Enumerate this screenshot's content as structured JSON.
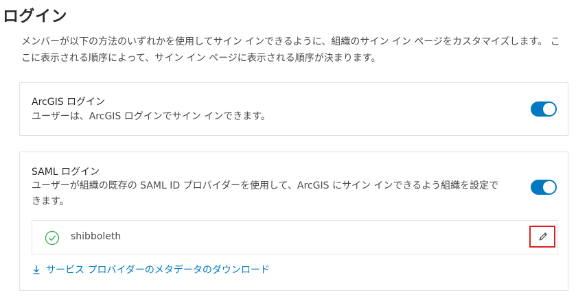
{
  "page": {
    "title": "ログイン",
    "intro": "メンバーが以下の方法のいずれかを使用してサイン インできるように、組織のサイン イン ページをカスタマイズします。 ここに表示される順序によって、サイン イン ページに表示される順序が決まります。"
  },
  "arcgis_login": {
    "title": "ArcGIS ログイン",
    "description": "ユーザーは、ArcGIS ログインでサイン インできます。",
    "enabled": true
  },
  "saml_login": {
    "title": "SAML ログイン",
    "description": "ユーザーが組織の既存の SAML ID プロバイダーを使用して、ArcGIS にサイン インできるよう組織を設定できます。",
    "enabled": true,
    "provider": {
      "name": "shibboleth",
      "status_icon": "check-circle-icon",
      "edit_icon": "pencil-icon"
    },
    "download_link": {
      "label": "サービス プロバイダーのメタデータのダウンロード",
      "icon": "download-icon"
    }
  },
  "colors": {
    "accent": "#0079c1",
    "highlight": "#e02020",
    "success": "#35ac46"
  }
}
